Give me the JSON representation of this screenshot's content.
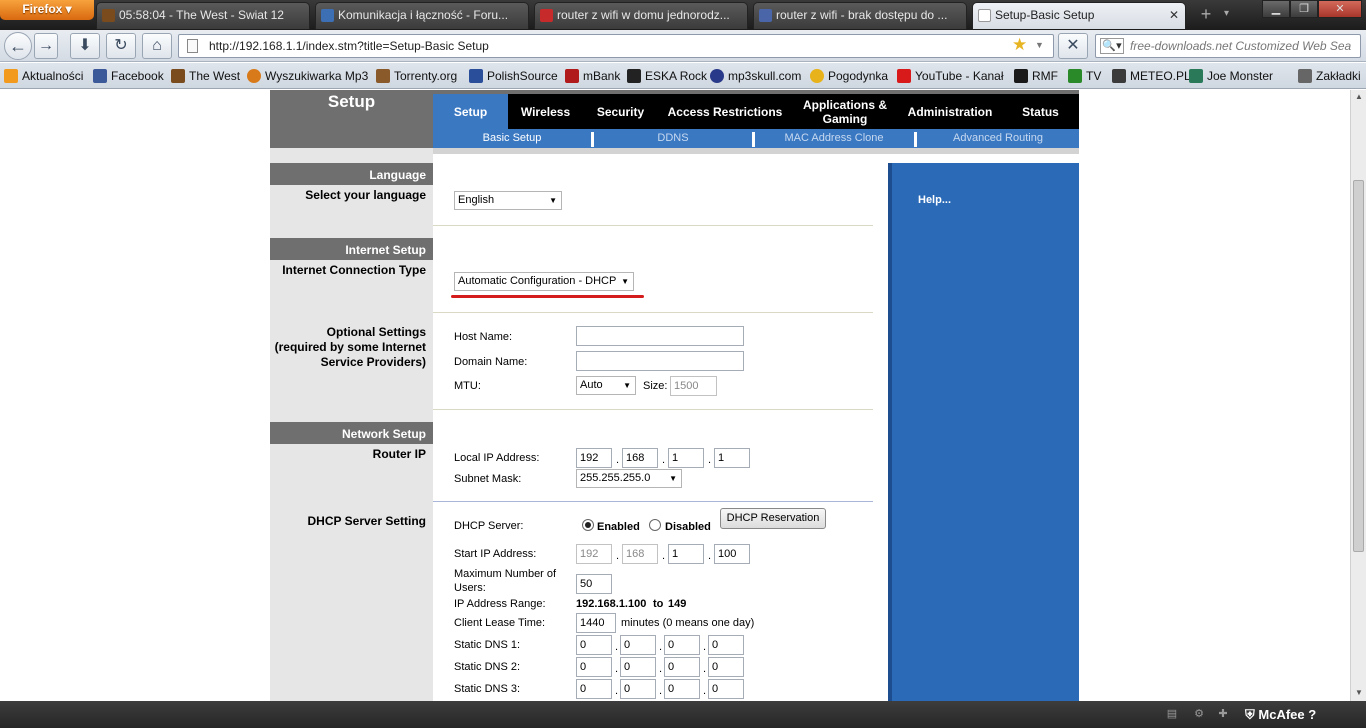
{
  "browser": {
    "menu_button": "Firefox",
    "tabs": [
      {
        "title": "05:58:04 - The West - Swiat 12",
        "icon_color": "#7a4b1c"
      },
      {
        "title": "Komunikacja i łączność - Foru...",
        "icon_color": "#3d6fb5"
      },
      {
        "title": "router z wifi w domu jednorodz...",
        "icon_color": "#c62a2a"
      },
      {
        "title": "router z wifi - brak dostępu do ...",
        "icon_color": "#4a66a8"
      },
      {
        "title": "Setup-Basic Setup",
        "icon_color": "#dddddd"
      }
    ],
    "url": "http://192.168.1.1/index.stm?title=Setup-Basic Setup",
    "search_placeholder": "free-downloads.net Customized Web Sea",
    "bookmarks": [
      {
        "label": "Aktualności",
        "icon_color": "#f29a1e"
      },
      {
        "label": "Facebook",
        "icon_color": "#3b5998"
      },
      {
        "label": "The West",
        "icon_color": "#7a4b1c"
      },
      {
        "label": "Wyszukiwarka Mp3",
        "icon_color": "#d87a1a"
      },
      {
        "label": "Torrenty.org",
        "icon_color": "#8a5a2a"
      },
      {
        "label": "PolishSource",
        "icon_color": "#2a4e9a"
      },
      {
        "label": "mBank",
        "icon_color": "#b11a1a"
      },
      {
        "label": "ESKA Rock",
        "icon_color": "#222222"
      },
      {
        "label": "mp3skull.com",
        "icon_color": "#2a3a8a"
      },
      {
        "label": "Pogodynka",
        "icon_color": "#e8b21a"
      },
      {
        "label": "YouTube - Kanał",
        "icon_color": "#d91a1a"
      },
      {
        "label": "RMF",
        "icon_color": "#1a1a1a"
      },
      {
        "label": "TV",
        "icon_color": "#2a8a2a"
      },
      {
        "label": "METEO.PL",
        "icon_color": "#3a3a3a"
      },
      {
        "label": "Joe Monster",
        "icon_color": "#2a7a5a"
      },
      {
        "label": "Zakładki",
        "icon_color": "#666666"
      }
    ]
  },
  "router": {
    "page_title": "Setup",
    "main_tabs": [
      "Setup",
      "Wireless",
      "Security",
      "Access Restrictions",
      "Applications &\nGaming",
      "Administration",
      "Status"
    ],
    "sub_tabs": [
      "Basic Setup",
      "DDNS",
      "MAC Address Clone",
      "Advanced Routing"
    ],
    "sections": {
      "language": {
        "header": "Language",
        "label": "Select your language",
        "value": "English"
      },
      "internet": {
        "header": "Internet Setup",
        "label": "Internet Connection Type",
        "value": "Automatic Configuration - DHCP"
      },
      "optional": {
        "label": "Optional Settings\n(required by some Internet\nService Providers)",
        "host_name_label": "Host Name:",
        "host_name_value": "",
        "domain_name_label": "Domain Name:",
        "domain_name_value": "",
        "mtu_label": "MTU:",
        "mtu_value": "Auto",
        "size_label": "Size:",
        "size_value": "1500"
      },
      "network": {
        "header": "Network Setup",
        "label": "Router IP",
        "local_ip_label": "Local IP Address:",
        "local_ip": [
          "192",
          "168",
          "1",
          "1"
        ],
        "subnet_label": "Subnet Mask:",
        "subnet_value": "255.255.255.0"
      },
      "dhcp": {
        "label": "DHCP Server Setting",
        "server_label": "DHCP Server:",
        "enabled_label": "Enabled",
        "disabled_label": "Disabled",
        "enabled_selected": true,
        "reservation_button": "DHCP Reservation",
        "start_ip_label": "Start IP Address:",
        "start_ip": [
          "192",
          "168",
          "1",
          "100"
        ],
        "max_users_label": "Maximum Number of\nUsers:",
        "max_users": "50",
        "range_label": "IP Address Range:",
        "range_start": "192.168.1.100",
        "range_to": "to",
        "range_end": "149",
        "lease_label": "Client Lease Time:",
        "lease_value": "1440",
        "lease_suffix": "minutes (0 means one day)",
        "dns1_label": "Static DNS 1:",
        "dns1": [
          "0",
          "0",
          "0",
          "0"
        ],
        "dns2_label": "Static DNS 2:",
        "dns2": [
          "0",
          "0",
          "0",
          "0"
        ],
        "dns3_label": "Static DNS 3:",
        "dns3": [
          "0",
          "0",
          "0",
          "0"
        ]
      }
    },
    "help_link": "Help..."
  },
  "statusbar": {
    "mcafee": "McAfee",
    "help_glyph": "?"
  }
}
